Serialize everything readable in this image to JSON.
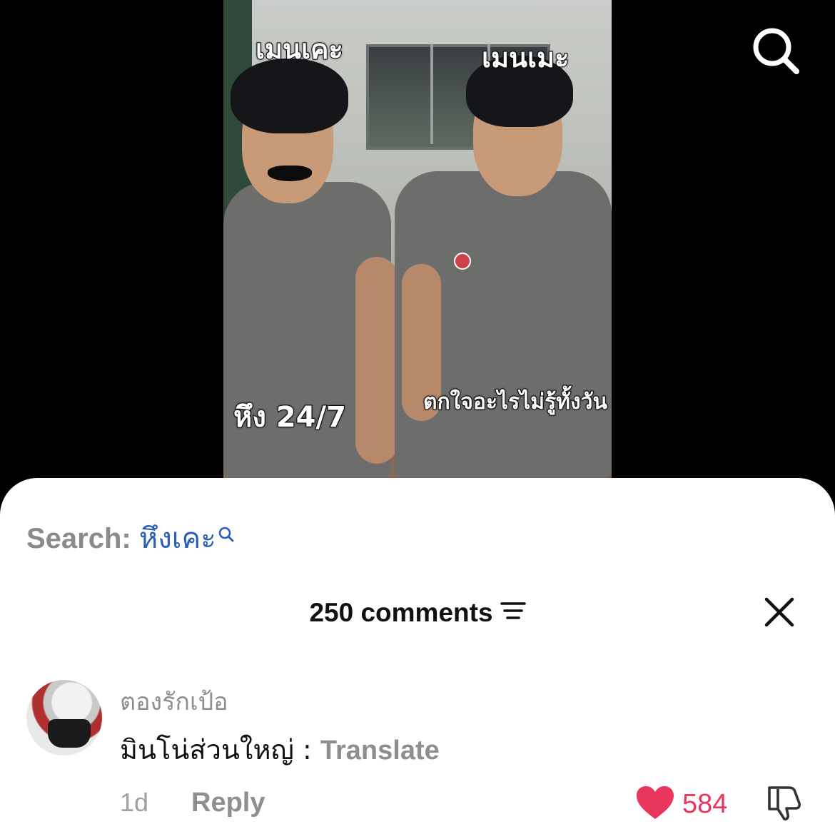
{
  "video": {
    "overlay_top_left": "เมนเคะ",
    "overlay_top_right": "เมนเมะ",
    "overlay_bottom_left": "หึง 24/7",
    "overlay_bottom_right": "ตกใจอะไรไม่รู้ทั้งวัน"
  },
  "header": {
    "search_icon": "search-icon"
  },
  "sheet": {
    "search_prefix": "Search:",
    "search_keyword": "หึงเคะ",
    "search_keyword_icon": "search-icon",
    "comment_count": "250 comments",
    "sort_icon": "sort-icon",
    "close_icon": "close-icon"
  },
  "comments": [
    {
      "username": "ตองรักเป้อ",
      "text": "มินโน่ส่วนใหญ่ :",
      "translate_label": "Translate",
      "age": "1d",
      "reply_label": "Reply",
      "like_count": "584",
      "like_icon": "heart-icon",
      "dislike_icon": "thumbs-down-icon"
    }
  ],
  "colors": {
    "like": "#e8365d",
    "link": "#2a5fb5",
    "muted": "#8e8e8e"
  }
}
